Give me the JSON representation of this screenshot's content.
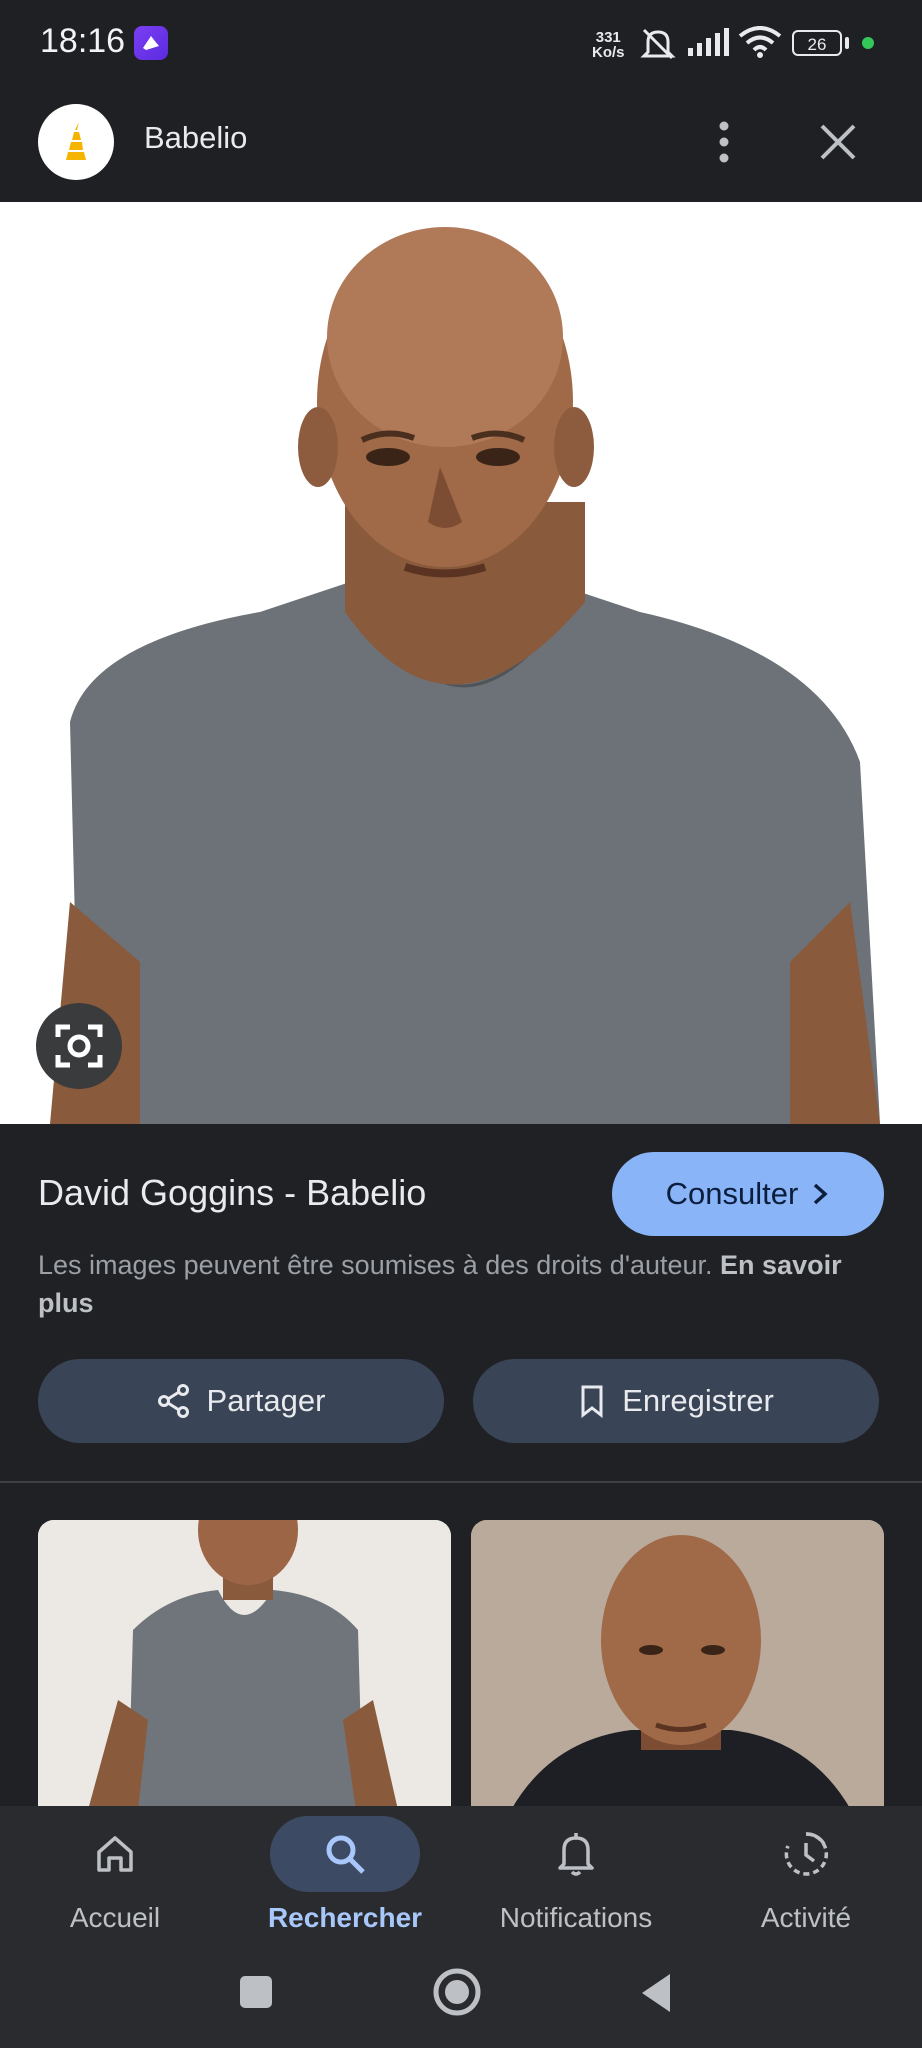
{
  "status_bar": {
    "time": "18:16",
    "net_speed_value": "331",
    "net_speed_unit": "Ko/s",
    "battery": "26"
  },
  "header": {
    "site_name": "Babelio"
  },
  "result": {
    "title": "David Goggins - Babelio",
    "consult_label": "Consulter",
    "copyright_text": "Les images peuvent être soumises à des droits d'auteur. ",
    "learn_more": "En savoir plus"
  },
  "actions": {
    "share_label": "Partager",
    "save_label": "Enregistrer"
  },
  "bottom_nav": {
    "items": [
      {
        "label": "Accueil",
        "icon": "home-icon"
      },
      {
        "label": "Rechercher",
        "icon": "search-icon",
        "active": true
      },
      {
        "label": "Notifications",
        "icon": "bell-icon"
      },
      {
        "label": "Activité",
        "icon": "history-icon"
      }
    ]
  },
  "colors": {
    "background": "#202124",
    "accent": "#8ab4f8",
    "pill": "#394457",
    "active_nav": "#a8c7fa"
  }
}
